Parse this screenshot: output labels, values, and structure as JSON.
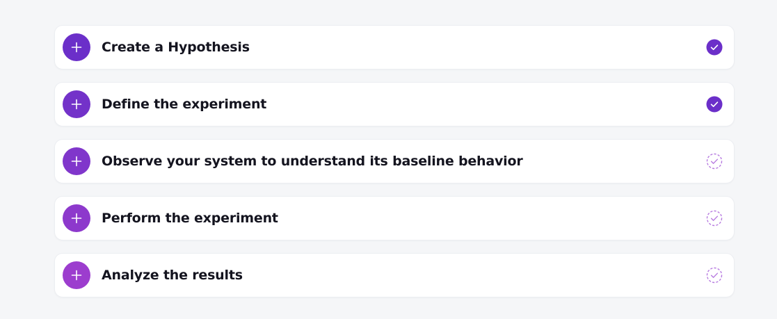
{
  "colors": {
    "background": "#f5f6f8",
    "card": "#ffffff",
    "title_text": "#14141f",
    "check_done": "#6b2fc9",
    "check_pending": "#b77be0"
  },
  "steps": [
    {
      "title": "Create a Hypothesis",
      "completed": true,
      "button_color": "#6b2fc9",
      "expand_icon": "plus-icon"
    },
    {
      "title": "Define the experiment",
      "completed": true,
      "button_color": "#7332c9",
      "expand_icon": "plus-icon"
    },
    {
      "title": "Observe your system to understand its baseline behavior",
      "completed": false,
      "button_color": "#8036cb",
      "expand_icon": "plus-icon"
    },
    {
      "title": "Perform the experiment",
      "completed": false,
      "button_color": "#8d39cc",
      "expand_icon": "plus-icon"
    },
    {
      "title": "Analyze the results",
      "completed": false,
      "button_color": "#9c3dce",
      "expand_icon": "plus-icon"
    }
  ]
}
